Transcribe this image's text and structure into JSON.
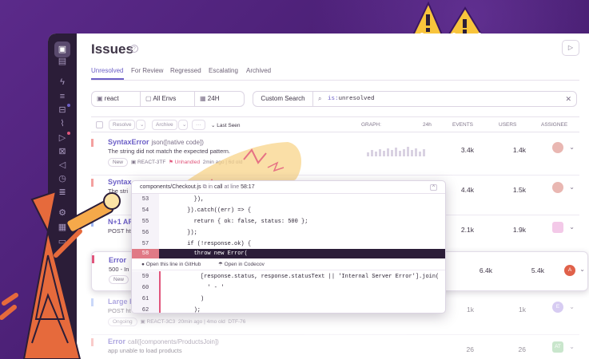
{
  "page": {
    "title": "Issues",
    "help_icon": "question-icon",
    "top_button_icon": "play-icon"
  },
  "tabs": [
    {
      "label": "Unresolved",
      "active": true
    },
    {
      "label": "For Review"
    },
    {
      "label": "Regressed"
    },
    {
      "label": "Escalating"
    },
    {
      "label": "Archived"
    }
  ],
  "filters": {
    "project": "react",
    "env": "All Envs",
    "time": "24H",
    "saved_search": "Custom Search",
    "query_key": "is:",
    "query_value": "unresolved"
  },
  "table_header": {
    "resolve": "Resolve",
    "archive": "Archive",
    "more": "···",
    "sort": "Last Seen",
    "graph": "GRAPH:",
    "period": "24h",
    "events": "EVENTS",
    "users": "USERS",
    "assignee": "ASSIGNEE"
  },
  "issues": [
    {
      "title": "SyntaxError",
      "culprit": "json([native code])",
      "message": "The string did not match the expected pattern.",
      "badge": "New",
      "short_id": "REACT-3TF",
      "status": "Unhandled",
      "age": "2min ago | 6d old",
      "events": "3.4k",
      "users": "1.4k",
      "level_color": "#f4a09f"
    },
    {
      "title": "Syntax",
      "culprit": "",
      "message": "The stri",
      "events": "4.4k",
      "users": "1.5k",
      "level_color": "#f4a09f"
    },
    {
      "title": "N+1 AP",
      "culprit": "",
      "message": "POST htt",
      "events": "2.1k",
      "users": "1.9k",
      "level_color": "#9fb8f4"
    },
    {
      "title": "Error",
      "culprit": "",
      "message": "500 - In",
      "badge": "New",
      "events": "6.4k",
      "users": "5.4k",
      "assignee": "A",
      "level_color": "#e1567c"
    },
    {
      "title": "Large R",
      "culprit": "",
      "message": "POST ht",
      "badge": "Ongoing",
      "short_id": "REACT-3C3",
      "age": "20min ago | 4mo old",
      "extra": "DTF-76",
      "events": "1k",
      "users": "1k",
      "assignee": "E",
      "level_color": "#9fb8f4"
    },
    {
      "title": "Error",
      "culprit": "call([components/ProductsJoin])",
      "message": "app unable to load products",
      "events": "26",
      "users": "26",
      "assignee": "AT",
      "level_color": "#f4a09f"
    }
  ],
  "code": {
    "file": "components/Checkout.js",
    "in_label": "in",
    "fn": "call",
    "at_line_label": "at line",
    "position": "58:17",
    "lines": [
      {
        "n": "53",
        "t": "        }),"
      },
      {
        "n": "54",
        "t": "      }).catch((err) => {"
      },
      {
        "n": "55",
        "t": "        return { ok: false, status: 500 };"
      },
      {
        "n": "56",
        "t": "      });"
      },
      {
        "n": "57",
        "t": "      if (!response.ok) {"
      },
      {
        "n": "58",
        "t": "        throw new Error("
      },
      {
        "n": "59",
        "t": "          [response.status, response.statusText || 'Internal Server Error'].join("
      },
      {
        "n": "60",
        "t": "            ' - '"
      },
      {
        "n": "61",
        "t": "          )"
      },
      {
        "n": "62",
        "t": "        );"
      }
    ],
    "link_github": "Open this line in GitHub",
    "link_codecov": "Open in Codecov"
  }
}
